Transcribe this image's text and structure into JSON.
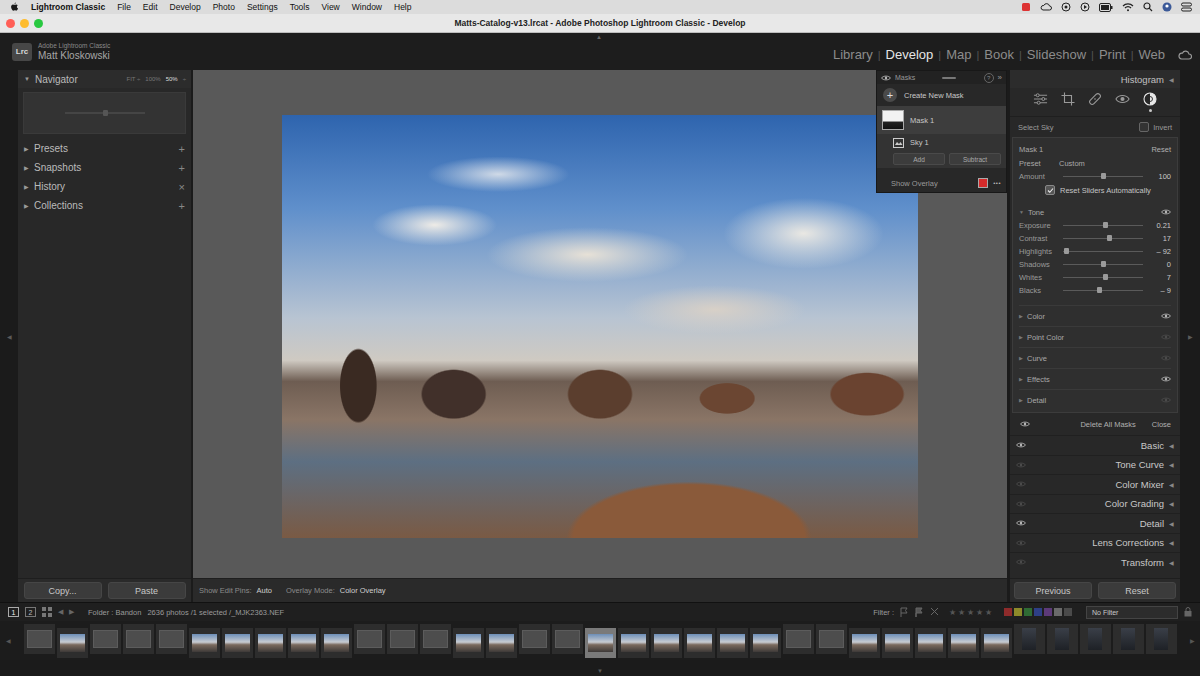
{
  "menu_bar": {
    "app": "Lightroom Classic",
    "items": [
      "File",
      "Edit",
      "Develop",
      "Photo",
      "Settings",
      "Tools",
      "View",
      "Window",
      "Help"
    ]
  },
  "window": {
    "title": "Matts-Catalog-v13.lrcat - Adobe Photoshop Lightroom Classic - Develop"
  },
  "identity_plate": {
    "logo": "Lrc",
    "product": "Adobe Lightroom Classic",
    "user": "Matt Kloskowski"
  },
  "modules": [
    {
      "label": "Library",
      "selected": false
    },
    {
      "label": "Develop",
      "selected": true
    },
    {
      "label": "Map",
      "selected": false
    },
    {
      "label": "Book",
      "selected": false
    },
    {
      "label": "Slideshow",
      "selected": false
    },
    {
      "label": "Print",
      "selected": false
    },
    {
      "label": "Web",
      "selected": false
    }
  ],
  "module_separator": "|",
  "panel_toggles": {
    "top": "▲",
    "bottom": "▼",
    "left": "◀",
    "right": "▶"
  },
  "glyphs": {
    "expanded": "▼",
    "collapsed": "▶",
    "panel_collapsed": "◀"
  },
  "left_panel": {
    "navigator": {
      "title": "Navigator",
      "expanded": true,
      "zoom_options": [
        {
          "label": "FIT ÷",
          "selected": false
        },
        {
          "label": "100%",
          "selected": false
        },
        {
          "label": "50%",
          "selected": true
        },
        {
          "label": "÷",
          "selected": false
        }
      ]
    },
    "sections": [
      {
        "label": "Presets",
        "action": "+",
        "expanded": false
      },
      {
        "label": "Snapshots",
        "action": "+",
        "expanded": false
      },
      {
        "label": "History",
        "action": "×",
        "expanded": false
      },
      {
        "label": "Collections",
        "action": "+",
        "expanded": false
      }
    ],
    "buttons": [
      "Copy...",
      "Paste"
    ]
  },
  "toolbar": {
    "items": [
      {
        "label": "Show Edit Pins:",
        "value": "Auto"
      },
      {
        "label": "Overlay Mode:",
        "value": "Color Overlay"
      }
    ]
  },
  "masks_panel": {
    "title": "Masks",
    "help": "?",
    "collapse": "»",
    "create": {
      "icon": "+",
      "label": "Create New Mask"
    },
    "masks": [
      {
        "label": "Mask 1",
        "selected": true,
        "components": [
          {
            "label": "Sky 1",
            "selected": false
          }
        ]
      }
    ],
    "add": "Add",
    "subtract": "Subtract",
    "overlay": {
      "label": "Show Overlay",
      "color": "#d62b2b"
    },
    "more": "•••"
  },
  "right_panel": {
    "histogram": {
      "label": "Histogram"
    },
    "tools": [
      {
        "name": "edit",
        "selected": false
      },
      {
        "name": "crop",
        "selected": false
      },
      {
        "name": "healing",
        "selected": false
      },
      {
        "name": "red-eye",
        "selected": false
      },
      {
        "name": "masking",
        "selected": true
      }
    ],
    "mask_type": "Select Sky",
    "invert": {
      "label": "Invert",
      "checked": false
    },
    "mask_name": "Mask 1",
    "reset": "Reset",
    "preset": {
      "label": "Preset",
      "value": "Custom"
    },
    "amount": {
      "label": "Amount",
      "value": "100",
      "level": 0.5
    },
    "reset_sliders": {
      "label": "Reset Sliders Automatically",
      "checked": true
    },
    "tone": {
      "label": "Tone",
      "expanded": true,
      "enabled": true,
      "sliders": [
        {
          "label": "Exposure",
          "value": "0.21",
          "level": 0.526
        },
        {
          "label": "Contrast",
          "value": "17",
          "level": 0.585
        },
        {
          "label": "Highlights",
          "value": "– 92",
          "level": 0.04
        },
        {
          "label": "Shadows",
          "value": "0",
          "level": 0.5
        },
        {
          "label": "Whites",
          "value": "7",
          "level": 0.535
        },
        {
          "label": "Blacks",
          "value": "– 9",
          "level": 0.455
        }
      ]
    },
    "sections": [
      {
        "label": "Color",
        "expanded": false,
        "enabled": true
      },
      {
        "label": "Point Color",
        "expanded": false,
        "enabled": false
      },
      {
        "label": "Curve",
        "expanded": false,
        "enabled": false
      },
      {
        "label": "Effects",
        "expanded": false,
        "enabled": true
      },
      {
        "label": "Detail",
        "expanded": false,
        "enabled": false
      }
    ],
    "delete_all": "Delete All Masks",
    "close": "Close",
    "panels": [
      {
        "label": "Basic",
        "enabled": true
      },
      {
        "label": "Tone Curve",
        "enabled": false
      },
      {
        "label": "Color Mixer",
        "enabled": false
      },
      {
        "label": "Color Grading",
        "enabled": false
      },
      {
        "label": "Detail",
        "enabled": true
      },
      {
        "label": "Lens Corrections",
        "enabled": false
      },
      {
        "label": "Transform",
        "enabled": false
      }
    ],
    "buttons": [
      "Previous",
      "Reset"
    ]
  },
  "filter_bar": {
    "views": [
      {
        "label": "1",
        "selected": true
      },
      {
        "label": "2",
        "selected": false
      }
    ],
    "nav": [
      "◀",
      "▶"
    ],
    "folder": "Folder : Bandon",
    "count": "2636 photos /1 selected /_MJK2363.NEF",
    "filter_label": "Filter :",
    "stars": 0,
    "star_glyphs": [
      "★",
      "★",
      "★",
      "★",
      "★"
    ],
    "labels": [
      {
        "color": "#8e2b2b"
      },
      {
        "color": "#8d8a2a"
      },
      {
        "color": "#2f6b34"
      },
      {
        "color": "#2e3f86"
      },
      {
        "color": "#5d3a79"
      },
      {
        "color": "#6a6a6a"
      },
      {
        "color": "#4a4a4a"
      }
    ],
    "filter_value": "No Filter"
  },
  "filmstrip": {
    "scroll_left": "◀",
    "scroll_right": "▶",
    "thumbnails": [
      {
        "kind": "blank",
        "selected": false
      },
      {
        "kind": "photo",
        "selected": false
      },
      {
        "kind": "blank",
        "selected": false
      },
      {
        "kind": "blank",
        "selected": false
      },
      {
        "kind": "blank",
        "selected": false
      },
      {
        "kind": "photo",
        "selected": false
      },
      {
        "kind": "photo",
        "selected": false
      },
      {
        "kind": "photo",
        "selected": false
      },
      {
        "kind": "photo",
        "selected": false
      },
      {
        "kind": "photo",
        "selected": false
      },
      {
        "kind": "blank",
        "selected": false
      },
      {
        "kind": "blank",
        "selected": false
      },
      {
        "kind": "blank",
        "selected": false
      },
      {
        "kind": "photo",
        "selected": false
      },
      {
        "kind": "photo",
        "selected": false
      },
      {
        "kind": "blank",
        "selected": false
      },
      {
        "kind": "blank",
        "selected": false
      },
      {
        "kind": "photo",
        "selected": true
      },
      {
        "kind": "photo",
        "selected": false
      },
      {
        "kind": "photo",
        "selected": false
      },
      {
        "kind": "photo",
        "selected": false
      },
      {
        "kind": "photo",
        "selected": false
      },
      {
        "kind": "photo",
        "selected": false
      },
      {
        "kind": "blank",
        "selected": false
      },
      {
        "kind": "blank",
        "selected": false
      },
      {
        "kind": "photo",
        "selected": false
      },
      {
        "kind": "photo",
        "selected": false
      },
      {
        "kind": "photo",
        "selected": false
      },
      {
        "kind": "photo",
        "selected": false
      },
      {
        "kind": "photo",
        "selected": false
      },
      {
        "kind": "dark",
        "selected": false
      },
      {
        "kind": "dark",
        "selected": false
      },
      {
        "kind": "dark",
        "selected": false
      },
      {
        "kind": "dark",
        "selected": false
      },
      {
        "kind": "dark",
        "selected": false
      }
    ]
  }
}
